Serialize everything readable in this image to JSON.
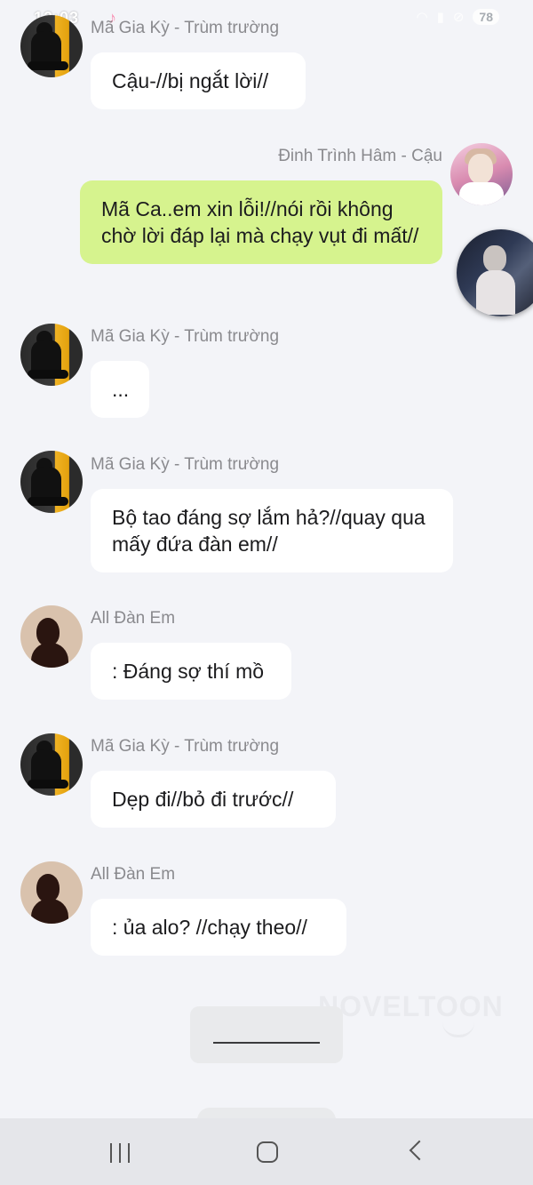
{
  "status_bar": {
    "time": "12:03",
    "battery": "78",
    "icons": [
      "tiktok-icon",
      "wifi-icon",
      "signal-icon",
      "dnd-icon",
      "battery-icon"
    ]
  },
  "messages": [
    {
      "sender": "Mã Gia Kỳ - Trùm trường",
      "text": "Cậu-//bị ngắt lời//",
      "side": "left",
      "avatar": "boy-avatar"
    },
    {
      "sender": "Đinh Trình Hâm - Cậu",
      "text": "Mã Ca..em xin lỗi!//nói rồi không chờ lời đáp lại mà chạy vụt đi mất//",
      "side": "right",
      "avatar": "cau-avatar"
    },
    {
      "sender": "Mã Gia Kỳ - Trùm trường",
      "text": "...",
      "side": "left",
      "avatar": "boy-avatar"
    },
    {
      "sender": "Mã Gia Kỳ - Trùm trường",
      "text": "Bộ tao đáng sợ lắm hả?//quay qua mấy đứa đàn em//",
      "side": "left",
      "avatar": "boy-avatar"
    },
    {
      "sender": "All Đàn Em",
      "text": ": Đáng sợ thí mồ",
      "side": "left",
      "avatar": "silhouette-avatar"
    },
    {
      "sender": "Mã Gia Kỳ - Trùm trường",
      "text": "Dẹp đi//bỏ đi trước//",
      "side": "left",
      "avatar": "boy-avatar"
    },
    {
      "sender": "All Đàn Em",
      "text": ": ủa alo? //chạy theo//",
      "side": "left",
      "avatar": "silhouette-avatar"
    }
  ],
  "watermark": "NOVELTOON",
  "colors": {
    "background": "#f3f4f8",
    "bubble": "#ffffff",
    "my_bubble": "#d6f38e",
    "name": "#8a8a8e"
  },
  "nav_icons": [
    "recent-apps-icon",
    "home-icon",
    "back-icon"
  ]
}
